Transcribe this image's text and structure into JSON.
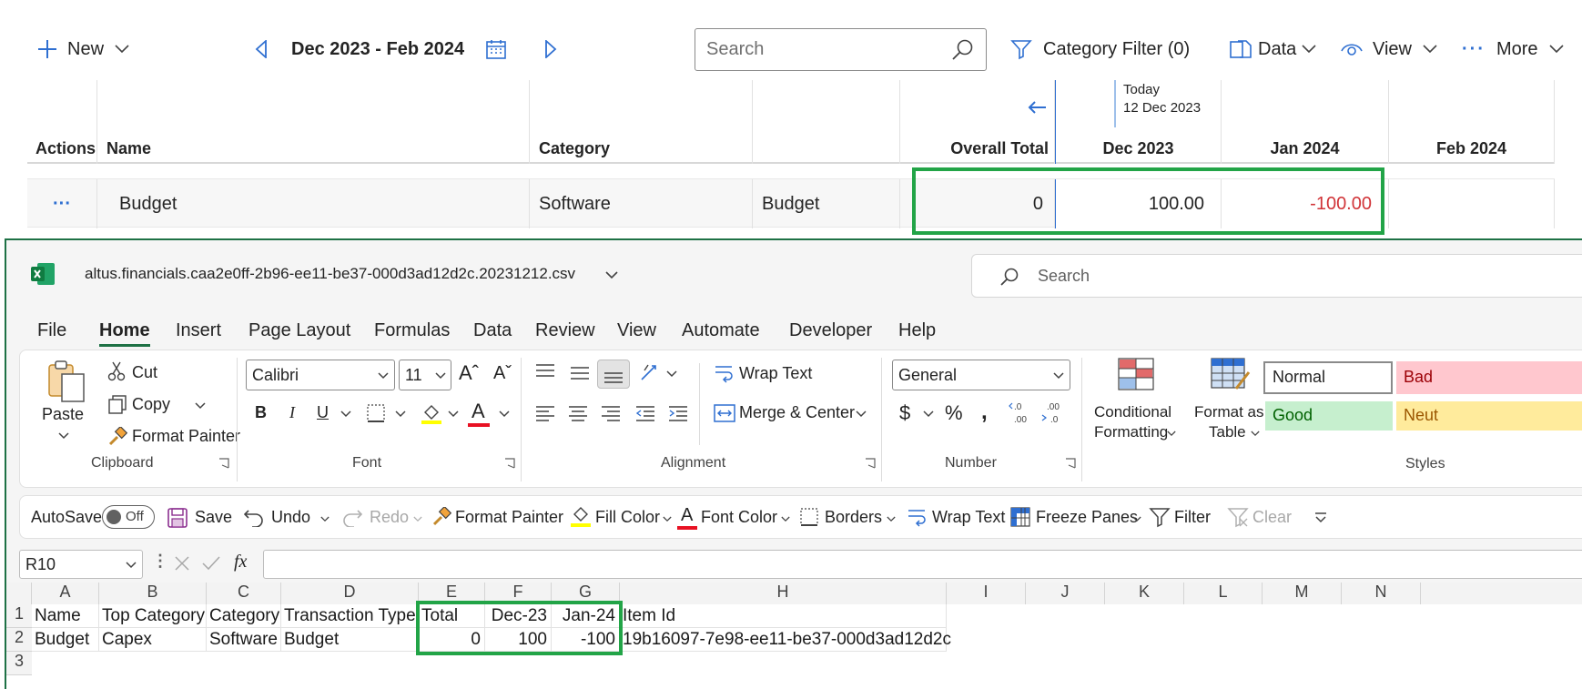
{
  "app": {
    "toolbar": {
      "new_label": "New",
      "date_range": "Dec 2023 - Feb 2024",
      "search_placeholder": "Search",
      "category_filter": "Category Filter (0)",
      "data_label": "Data",
      "view_label": "View",
      "more_label": "More"
    },
    "grid": {
      "columns": [
        "Actions",
        "Name",
        "Category",
        "",
        "Overall Total",
        "Dec 2023",
        "Jan 2024",
        "Feb 2024"
      ],
      "today_label": "Today",
      "today_date": "12 Dec 2023",
      "row": {
        "actions": "···",
        "name": "Budget",
        "category": "Software",
        "type": "Budget",
        "overall_total": "0",
        "dec_2023": "100.00",
        "jan_2024": "-100.00",
        "feb_2024": ""
      }
    },
    "colors": {
      "accent": "#2f6fd1",
      "negative": "#d13438",
      "highlight": "#22a447",
      "excel_green": "#1e7145"
    }
  },
  "excel": {
    "file_name": "altus.financials.caa2e0ff-2b96-ee11-be37-000d3ad12d2c.20231212.csv",
    "search_placeholder": "Search",
    "menu": [
      "File",
      "Home",
      "Insert",
      "Page Layout",
      "Formulas",
      "Data",
      "Review",
      "View",
      "Automate",
      "Developer",
      "Help"
    ],
    "ribbon": {
      "paste": "Paste",
      "cut": "Cut",
      "copy": "Copy",
      "format_painter": "Format Painter",
      "clipboard_group": "Clipboard",
      "font_name": "Calibri",
      "font_size": "11",
      "font_group": "Font",
      "wrap_text": "Wrap Text",
      "merge_center": "Merge & Center",
      "alignment_group": "Alignment",
      "number_format": "General",
      "number_group": "Number",
      "conditional_formatting": [
        "Conditional",
        "Formatting"
      ],
      "format_as_table": [
        "Format as",
        "Table"
      ],
      "styles": {
        "normal": "Normal",
        "bad": "Bad",
        "good": "Good",
        "neutral": "Neut"
      },
      "styles_group": "Styles"
    },
    "qat": {
      "autosave": "AutoSave",
      "toggle": "Off",
      "save": "Save",
      "undo": "Undo",
      "redo": "Redo",
      "format_painter": "Format Painter",
      "fill_color": "Fill Color",
      "font_color": "Font Color",
      "borders": "Borders",
      "wrap_text": "Wrap Text",
      "freeze_panes": "Freeze Panes",
      "filter": "Filter",
      "clear": "Clear"
    },
    "name_box": "R10",
    "fx": "fx",
    "column_letters": [
      "A",
      "B",
      "C",
      "D",
      "E",
      "F",
      "G",
      "H",
      "I",
      "J",
      "K",
      "L",
      "M",
      "N"
    ],
    "row_numbers": [
      "1",
      "2",
      "3"
    ],
    "rows": [
      [
        "Name",
        "Top Category",
        "Category",
        "Transaction Type",
        "Total",
        "Dec-23",
        "Jan-24",
        "Item Id"
      ],
      [
        "Budget",
        "Capex",
        "Software",
        "Budget",
        "0",
        "100",
        "-100",
        "19b16097-7e98-ee11-be37-000d3ad12d2c"
      ]
    ]
  }
}
